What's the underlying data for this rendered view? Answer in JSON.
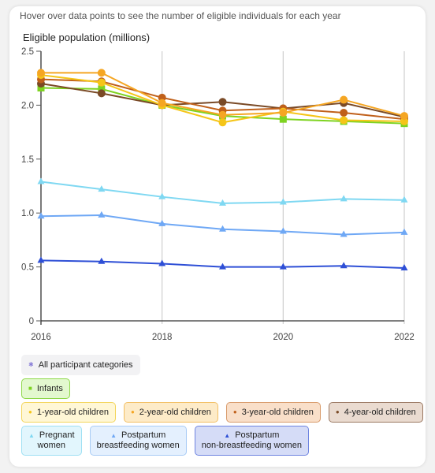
{
  "hint": "Hover over data points to see the number of eligible individuals for each year",
  "chart_data": {
    "type": "line",
    "title": "",
    "ylabel": "Eligible population (millions)",
    "xlabel": "",
    "x": [
      2016,
      2017,
      2018,
      2019,
      2020,
      2021,
      2022
    ],
    "xticks": [
      "2016",
      "2018",
      "2020",
      "2022"
    ],
    "yticks": [
      "0",
      "0.5",
      "1.0",
      "1.5",
      "2.0",
      "2.5"
    ],
    "ylim": [
      0,
      2.5
    ],
    "grid": "vertical at labeled years",
    "series": [
      {
        "name": "2-year-old children",
        "color": "#f5a623",
        "marker": "circle",
        "values": [
          2.3,
          2.3,
          2.02,
          1.91,
          1.93,
          2.05,
          1.9
        ]
      },
      {
        "name": "1-year-old children",
        "color": "#f5c518",
        "marker": "circle",
        "values": [
          2.28,
          2.21,
          2.0,
          1.84,
          1.94,
          1.86,
          1.85
        ]
      },
      {
        "name": "3-year-old children",
        "color": "#c0601a",
        "marker": "circle",
        "values": [
          2.24,
          2.22,
          2.07,
          1.95,
          1.97,
          1.93,
          1.87
        ]
      },
      {
        "name": "4-year-old children",
        "color": "#7a4a26",
        "marker": "circle",
        "values": [
          2.2,
          2.11,
          2.0,
          2.03,
          1.97,
          2.02,
          1.89
        ]
      },
      {
        "name": "Infants",
        "color": "#7ed321",
        "marker": "square",
        "values": [
          2.16,
          2.15,
          2.0,
          1.9,
          1.87,
          1.85,
          1.83
        ]
      },
      {
        "name": "Pregnant women",
        "color": "#7fd8f2",
        "marker": "triangle",
        "values": [
          1.29,
          1.22,
          1.15,
          1.09,
          1.1,
          1.13,
          1.12
        ]
      },
      {
        "name": "Postpartum breastfeeding women",
        "color": "#6fa8f5",
        "marker": "triangle",
        "values": [
          0.97,
          0.98,
          0.9,
          0.85,
          0.83,
          0.8,
          0.82
        ]
      },
      {
        "name": "Postpartum non-breastfeeding women",
        "color": "#2e4fd6",
        "marker": "triangle",
        "values": [
          0.56,
          0.55,
          0.53,
          0.5,
          0.5,
          0.51,
          0.49
        ]
      }
    ]
  },
  "legend": {
    "all": {
      "label": "All participant categories",
      "marker": "✱",
      "bg": "#f2f2f4",
      "border": "#f2f2f4",
      "color": "#8a7fd8"
    },
    "rows": [
      [
        {
          "label": "Infants",
          "marker": "■",
          "bg": "#e3f8cf",
          "border": "#8ed84a",
          "color": "#7ed321"
        }
      ],
      [
        {
          "label": "1-year-old children",
          "marker": "●",
          "bg": "#fff7d6",
          "border": "#f3d55a",
          "color": "#f5c518"
        },
        {
          "label": "2-year-old children",
          "marker": "●",
          "bg": "#fdebc8",
          "border": "#f2bf63",
          "color": "#f5a623"
        },
        {
          "label": "3-year-old children",
          "marker": "●",
          "bg": "#f9dfc9",
          "border": "#d89a6a",
          "color": "#c0601a"
        },
        {
          "label": "4-year-old children",
          "marker": "●",
          "bg": "#eadbd0",
          "border": "#9a7862",
          "color": "#7a4a26"
        }
      ],
      [
        {
          "label": "Pregnant\nwomen",
          "marker": "▲",
          "bg": "#e2f6fd",
          "border": "#9fe0f3",
          "color": "#7fd8f2"
        },
        {
          "label": "Postpartum\nbreastfeeding women",
          "marker": "▲",
          "bg": "#e4f0fe",
          "border": "#a9ccf5",
          "color": "#6fa8f5"
        },
        {
          "label": "Postpartum\nnon-breastfeeding women",
          "marker": "▲",
          "bg": "#d5dcf7",
          "border": "#6e84e0",
          "color": "#2e4fd6"
        }
      ]
    ]
  }
}
